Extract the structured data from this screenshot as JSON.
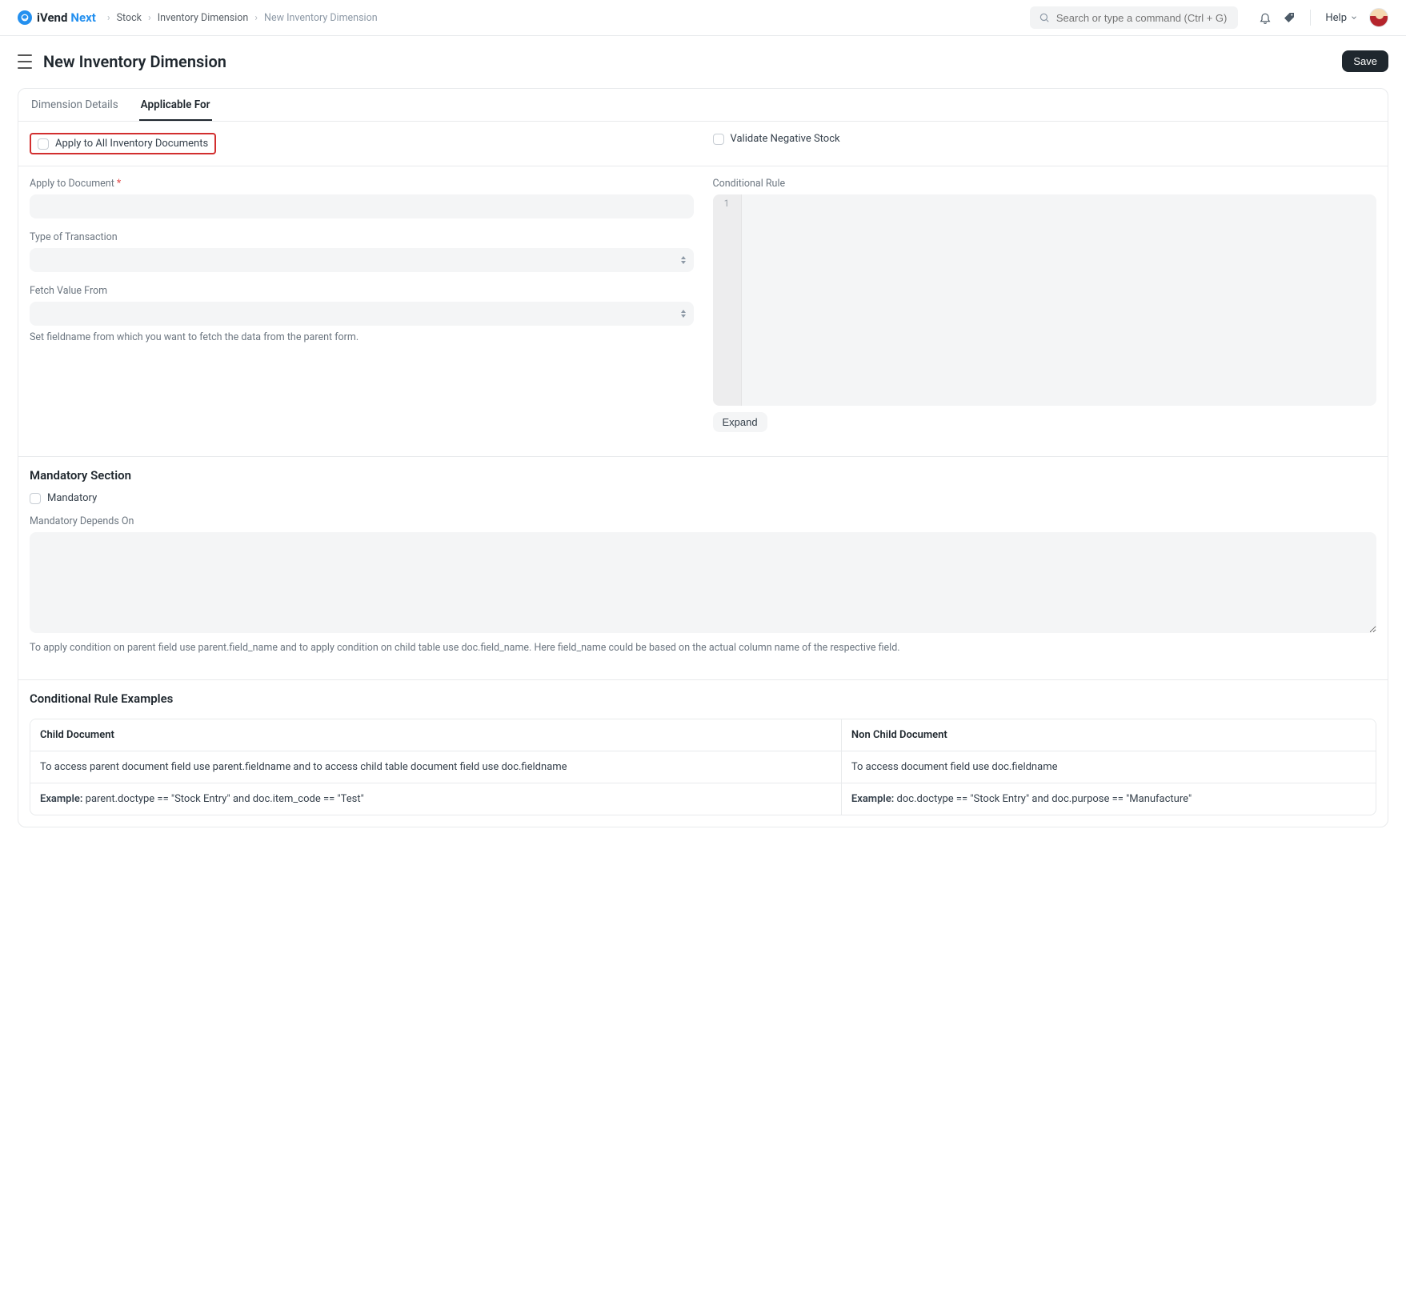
{
  "brand": {
    "prefix": "iVend",
    "suffix": "Next"
  },
  "breadcrumbs": {
    "items": [
      "Stock",
      "Inventory Dimension"
    ],
    "current": "New Inventory Dimension"
  },
  "search": {
    "placeholder": "Search or type a command (Ctrl + G)"
  },
  "help_label": "Help",
  "page_title": "New Inventory Dimension",
  "save_label": "Save",
  "tabs": {
    "details": "Dimension Details",
    "applicable": "Applicable For"
  },
  "checkboxes": {
    "apply_all": "Apply to All Inventory Documents",
    "validate_neg": "Validate Negative Stock",
    "mandatory": "Mandatory"
  },
  "fields": {
    "apply_doc": {
      "label": "Apply to Document"
    },
    "type_txn": {
      "label": "Type of Transaction"
    },
    "fetch_from": {
      "label": "Fetch Value From",
      "help": "Set fieldname from which you want to fetch the data from the parent form."
    },
    "cond_rule": {
      "label": "Conditional Rule",
      "gutter1": "1"
    },
    "expand": "Expand",
    "mandatory_depends": {
      "label": "Mandatory Depends On",
      "help": "To apply condition on parent field use parent.field_name and to apply condition on child table use doc.field_name. Here field_name could be based on the actual column name of the respective field."
    }
  },
  "sections": {
    "mandatory": "Mandatory Section",
    "examples": "Conditional Rule Examples"
  },
  "examples": {
    "headers": {
      "child": "Child Document",
      "nonchild": "Non Child Document"
    },
    "row1": {
      "child": "To access parent document field use parent.fieldname and to access child table document field use doc.fieldname",
      "nonchild": "To access document field use doc.fieldname"
    },
    "row2": {
      "label": "Example:",
      "child": " parent.doctype == \"Stock Entry\" and doc.item_code == \"Test\"",
      "nonchild": " doc.doctype == \"Stock Entry\" and doc.purpose == \"Manufacture\""
    }
  }
}
